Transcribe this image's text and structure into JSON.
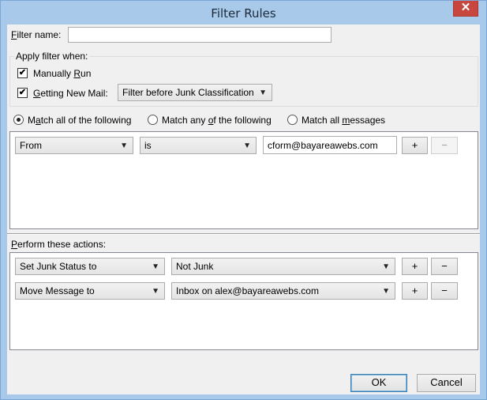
{
  "window": {
    "title": "Filter Rules",
    "close_glyph": "✕"
  },
  "filter_name": {
    "label": "Filter name:",
    "value": ""
  },
  "apply_when": {
    "label": "Apply filter when:",
    "manually_run": {
      "label": "Manually Run",
      "checked": true
    },
    "getting_new_mail": {
      "label": "Getting New Mail:",
      "checked": true
    },
    "timing_select": "Filter before Junk Classification"
  },
  "match": {
    "all": "Match all of the following",
    "any": "Match any of the following",
    "all_messages": "Match all messages",
    "selected": "all"
  },
  "conditions": [
    {
      "field": "From",
      "operator": "is",
      "value": "cform@bayareawebs.com",
      "add": "+",
      "remove": "−"
    }
  ],
  "actions_label": "Perform these actions:",
  "actions": [
    {
      "action": "Set Junk Status to",
      "target": "Not Junk",
      "add": "+",
      "remove": "−"
    },
    {
      "action": "Move Message to",
      "target": "Inbox on alex@bayareawebs.com",
      "add": "+",
      "remove": "−"
    }
  ],
  "buttons": {
    "ok": "OK",
    "cancel": "Cancel"
  },
  "check_glyph": "✔",
  "dropdown_glyph": "▼"
}
